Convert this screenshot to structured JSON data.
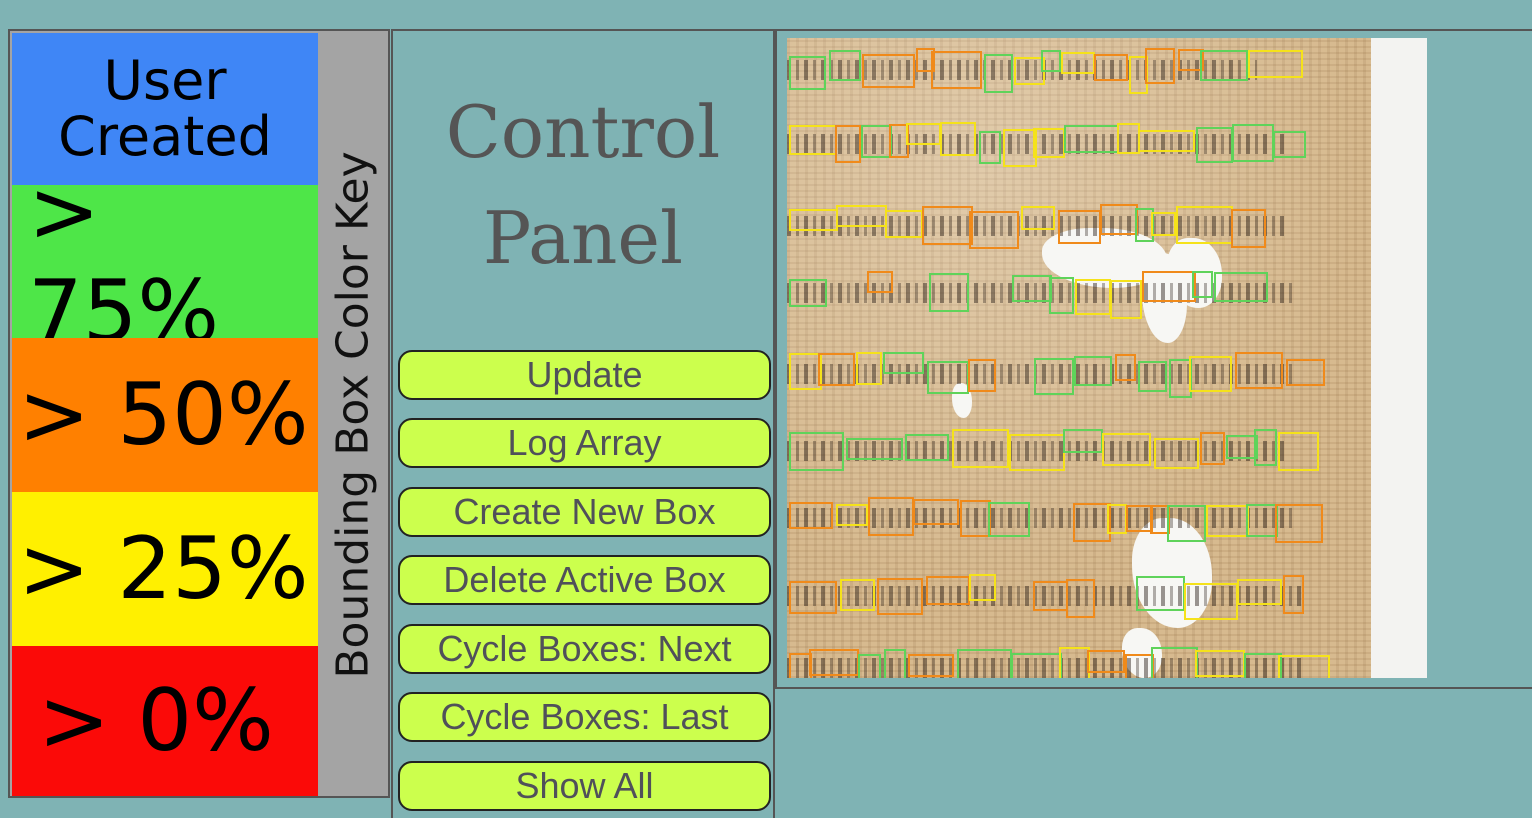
{
  "color_key": {
    "title": "Bounding Box Color Key",
    "bands": [
      {
        "label": "User\nCreated",
        "color": "#3f86f6"
      },
      {
        "label": "> 75%",
        "color": "#4ee648"
      },
      {
        "label": "> 50%",
        "color": "#ff8000"
      },
      {
        "label": "> 25%",
        "color": "#fff000"
      },
      {
        "label": "> 0%",
        "color": "#fb0a08"
      }
    ]
  },
  "control_panel": {
    "title_line1": "Control",
    "title_line2": "Panel",
    "buttons": [
      {
        "label": "Update"
      },
      {
        "label": "Log Array"
      },
      {
        "label": "Create New Box"
      },
      {
        "label": "Delete Active Box"
      },
      {
        "label": "Cycle Boxes: Next"
      },
      {
        "label": "Cycle Boxes: Last"
      },
      {
        "label": "Show All"
      }
    ]
  },
  "viewer": {
    "box_colors": {
      "green": "#5fd35a",
      "orange": "#f08a1a",
      "yellow": "#f5e21a"
    }
  }
}
